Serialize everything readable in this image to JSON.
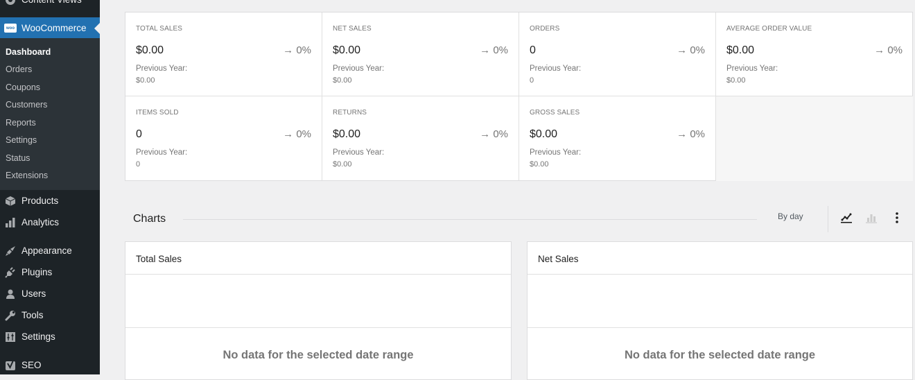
{
  "sidebar": {
    "top_partial": {
      "label": "Content Views",
      "icon": "content-views-icon"
    },
    "woocommerce": {
      "label": "WooCommerce",
      "icon": "woo-icon",
      "badge": "woo"
    },
    "submenu": [
      {
        "label": "Dashboard",
        "current": true
      },
      {
        "label": "Orders"
      },
      {
        "label": "Coupons"
      },
      {
        "label": "Customers"
      },
      {
        "label": "Reports"
      },
      {
        "label": "Settings"
      },
      {
        "label": "Status"
      },
      {
        "label": "Extensions"
      }
    ],
    "items": [
      {
        "label": "Products",
        "icon": "box-icon"
      },
      {
        "label": "Analytics",
        "icon": "bar-chart-icon"
      },
      {
        "label": "Appearance",
        "icon": "paintbrush-icon"
      },
      {
        "label": "Plugins",
        "icon": "plug-icon"
      },
      {
        "label": "Users",
        "icon": "user-icon"
      },
      {
        "label": "Tools",
        "icon": "wrench-icon"
      },
      {
        "label": "Settings",
        "icon": "sliders-icon"
      },
      {
        "label": "SEO",
        "icon": "yoast-icon"
      }
    ]
  },
  "stats": [
    {
      "label": "TOTAL SALES",
      "value": "$0.00",
      "delta": "0%",
      "prev_label": "Previous Year:",
      "prev_value": "$0.00"
    },
    {
      "label": "NET SALES",
      "value": "$0.00",
      "delta": "0%",
      "prev_label": "Previous Year:",
      "prev_value": "$0.00"
    },
    {
      "label": "ORDERS",
      "value": "0",
      "delta": "0%",
      "prev_label": "Previous Year:",
      "prev_value": "0"
    },
    {
      "label": "AVERAGE ORDER VALUE",
      "value": "$0.00",
      "delta": "0%",
      "prev_label": "Previous Year:",
      "prev_value": "$0.00"
    },
    {
      "label": "ITEMS SOLD",
      "value": "0",
      "delta": "0%",
      "prev_label": "Previous Year:",
      "prev_value": "0"
    },
    {
      "label": "RETURNS",
      "value": "$0.00",
      "delta": "0%",
      "prev_label": "Previous Year:",
      "prev_value": "$0.00"
    },
    {
      "label": "GROSS SALES",
      "value": "$0.00",
      "delta": "0%",
      "prev_label": "Previous Year:",
      "prev_value": "$0.00"
    }
  ],
  "charts": {
    "title": "Charts",
    "interval": "By day",
    "view_buttons": [
      {
        "name": "line-chart-icon",
        "active": true
      },
      {
        "name": "bar-chart-icon",
        "active": false
      },
      {
        "name": "more-vertical-icon",
        "active": false
      }
    ],
    "panels": [
      {
        "title": "Total Sales",
        "empty_message": "No data for the selected date range"
      },
      {
        "title": "Net Sales",
        "empty_message": "No data for the selected date range"
      }
    ]
  },
  "colors": {
    "sidebar_bg": "#1d2327",
    "submenu_bg": "#2c3338",
    "accent": "#2271b1",
    "page_bg": "#f0f0f1"
  }
}
